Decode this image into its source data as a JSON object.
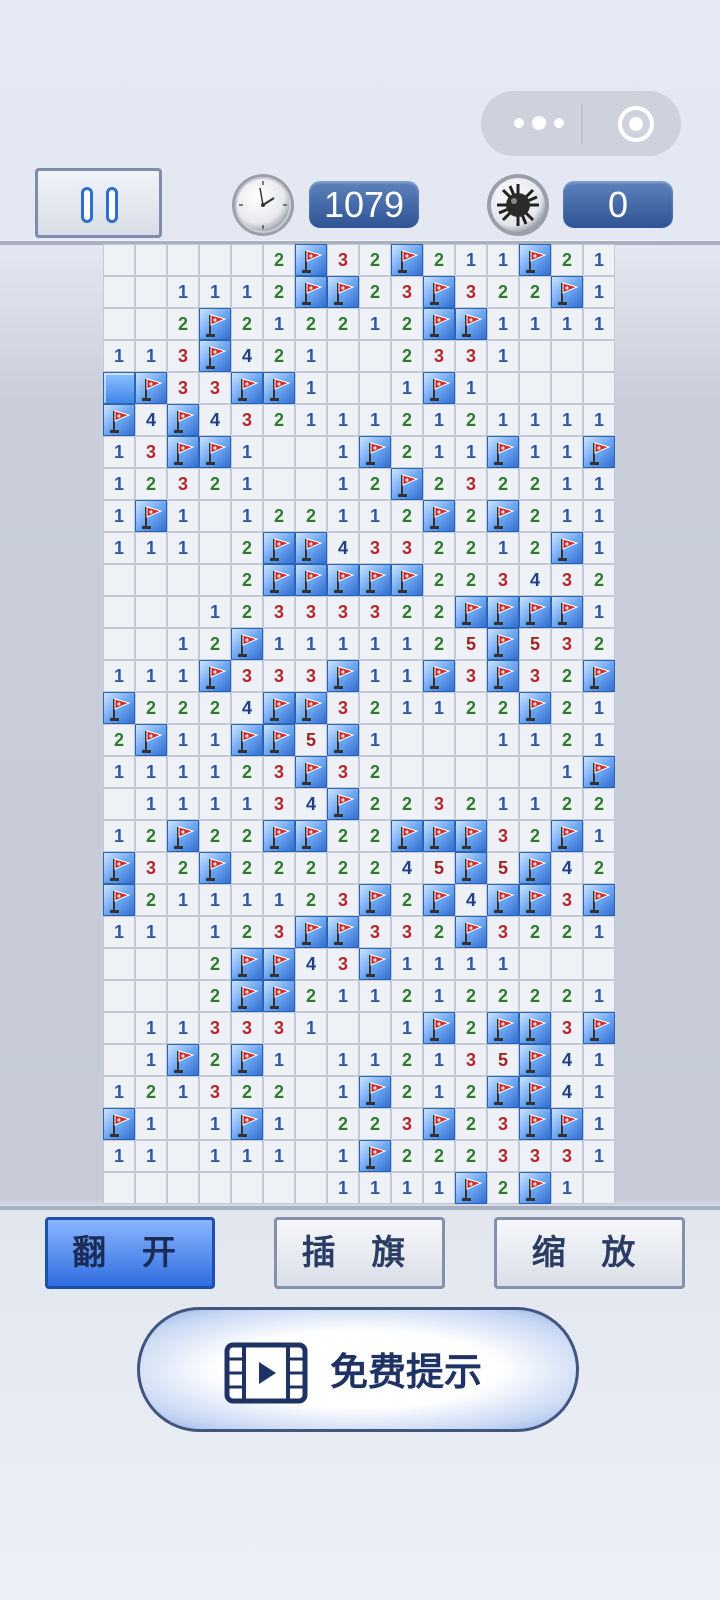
{
  "capsule": {
    "dots_icon": "more-dots-icon",
    "target_icon": "close-target-icon"
  },
  "header": {
    "pause_icon": "pause-icon",
    "clock_icon": "clock-icon",
    "timer": "1079",
    "mine_icon": "mine-icon",
    "mines_left": "0"
  },
  "board": {
    "cols": 16,
    "rows": 30,
    "legend": {
      "": "revealed-empty",
      "F": "flag",
      "U": "unrevealed"
    },
    "cells": [
      [
        "",
        "",
        "",
        "",
        "",
        "2",
        "F",
        "3",
        "2",
        "F",
        "2",
        "1",
        "1",
        "F",
        "2",
        "1"
      ],
      [
        "",
        "",
        "1",
        "1",
        "1",
        "2",
        "F",
        "F",
        "2",
        "3",
        "F",
        "3",
        "2",
        "2",
        "F",
        "1"
      ],
      [
        "",
        "",
        "2",
        "F",
        "2",
        "1",
        "2",
        "2",
        "1",
        "2",
        "F",
        "F",
        "1",
        "1",
        "1",
        "1"
      ],
      [
        "1",
        "1",
        "3",
        "F",
        "4",
        "2",
        "1",
        "",
        "",
        "2",
        "3",
        "3",
        "1",
        "",
        "",
        ""
      ],
      [
        "U",
        "F",
        "3",
        "3",
        "F",
        "F",
        "1",
        "",
        "",
        "1",
        "F",
        "1",
        "",
        "",
        "",
        ""
      ],
      [
        "F",
        "4",
        "F",
        "4",
        "3",
        "2",
        "1",
        "1",
        "1",
        "2",
        "1",
        "2",
        "1",
        "1",
        "1",
        "1"
      ],
      [
        "1",
        "3",
        "F",
        "F",
        "1",
        "",
        "",
        "1",
        "F",
        "2",
        "1",
        "1",
        "F",
        "1",
        "1",
        "F"
      ],
      [
        "1",
        "2",
        "3",
        "2",
        "1",
        "",
        "",
        "1",
        "2",
        "F",
        "2",
        "3",
        "2",
        "2",
        "1",
        "1"
      ],
      [
        "1",
        "F",
        "1",
        "",
        "1",
        "2",
        "2",
        "1",
        "1",
        "2",
        "F",
        "2",
        "F",
        "2",
        "1",
        "1"
      ],
      [
        "1",
        "1",
        "1",
        "",
        "2",
        "F",
        "F",
        "4",
        "3",
        "3",
        "2",
        "2",
        "1",
        "2",
        "F",
        "1"
      ],
      [
        "",
        "",
        "",
        "",
        "2",
        "F",
        "F",
        "F",
        "F",
        "F",
        "2",
        "2",
        "3",
        "4",
        "3",
        "2"
      ],
      [
        "",
        "",
        "",
        "1",
        "2",
        "3",
        "3",
        "3",
        "3",
        "2",
        "2",
        "F",
        "F",
        "F",
        "F",
        "1"
      ],
      [
        "",
        "",
        "1",
        "2",
        "F",
        "1",
        "1",
        "1",
        "1",
        "1",
        "2",
        "5",
        "F",
        "5",
        "3",
        "2"
      ],
      [
        "1",
        "1",
        "1",
        "F",
        "3",
        "3",
        "3",
        "F",
        "1",
        "1",
        "F",
        "3",
        "F",
        "3",
        "2",
        "F"
      ],
      [
        "F",
        "2",
        "2",
        "2",
        "4",
        "F",
        "F",
        "3",
        "2",
        "1",
        "1",
        "2",
        "2",
        "F",
        "2",
        "1"
      ],
      [
        "2",
        "F",
        "1",
        "1",
        "F",
        "F",
        "5",
        "F",
        "1",
        "",
        "",
        "",
        "1",
        "1",
        "2",
        "1"
      ],
      [
        "1",
        "1",
        "1",
        "1",
        "2",
        "3",
        "F",
        "3",
        "2",
        "",
        "",
        "",
        "",
        "",
        "1",
        "F"
      ],
      [
        "",
        "1",
        "1",
        "1",
        "1",
        "3",
        "4",
        "F",
        "2",
        "2",
        "3",
        "2",
        "1",
        "1",
        "2",
        "2"
      ],
      [
        "1",
        "2",
        "F",
        "2",
        "2",
        "F",
        "F",
        "2",
        "2",
        "F",
        "F",
        "F",
        "3",
        "2",
        "F",
        "1"
      ],
      [
        "F",
        "3",
        "2",
        "F",
        "2",
        "2",
        "2",
        "2",
        "2",
        "4",
        "5",
        "F",
        "5",
        "F",
        "4",
        "2"
      ],
      [
        "F",
        "2",
        "1",
        "1",
        "1",
        "1",
        "2",
        "3",
        "F",
        "2",
        "F",
        "4",
        "F",
        "F",
        "3",
        "F"
      ],
      [
        "1",
        "1",
        "",
        "1",
        "2",
        "3",
        "F",
        "F",
        "3",
        "3",
        "2",
        "F",
        "3",
        "2",
        "2",
        "1"
      ],
      [
        "",
        "",
        "",
        "2",
        "F",
        "F",
        "4",
        "3",
        "F",
        "1",
        "1",
        "1",
        "1",
        "",
        "",
        ""
      ],
      [
        "",
        "",
        "",
        "2",
        "F",
        "F",
        "2",
        "1",
        "1",
        "2",
        "1",
        "2",
        "2",
        "2",
        "2",
        "1"
      ],
      [
        "",
        "1",
        "1",
        "3",
        "3",
        "3",
        "1",
        "",
        "",
        "1",
        "F",
        "2",
        "F",
        "F",
        "3",
        "F"
      ],
      [
        "",
        "1",
        "F",
        "2",
        "F",
        "1",
        "",
        "1",
        "1",
        "2",
        "1",
        "3",
        "5",
        "F",
        "4",
        "1"
      ],
      [
        "1",
        "2",
        "1",
        "3",
        "2",
        "2",
        "",
        "1",
        "F",
        "2",
        "1",
        "2",
        "F",
        "F",
        "4",
        "1"
      ],
      [
        "F",
        "1",
        "",
        "1",
        "F",
        "1",
        "",
        "2",
        "2",
        "3",
        "F",
        "2",
        "3",
        "F",
        "F",
        "1"
      ],
      [
        "1",
        "1",
        "",
        "1",
        "1",
        "1",
        "",
        "1",
        "F",
        "2",
        "2",
        "2",
        "3",
        "3",
        "3",
        "1"
      ],
      [
        "",
        "",
        "",
        "",
        "",
        "",
        "",
        "1",
        "1",
        "1",
        "1",
        "F",
        "2",
        "F",
        "1",
        ""
      ]
    ]
  },
  "controls": {
    "reveal_label": "翻 开",
    "flag_label": "插 旗",
    "zoom_label": "缩 放",
    "hint_label": "免费提示",
    "hint_icon": "video-film-icon"
  }
}
